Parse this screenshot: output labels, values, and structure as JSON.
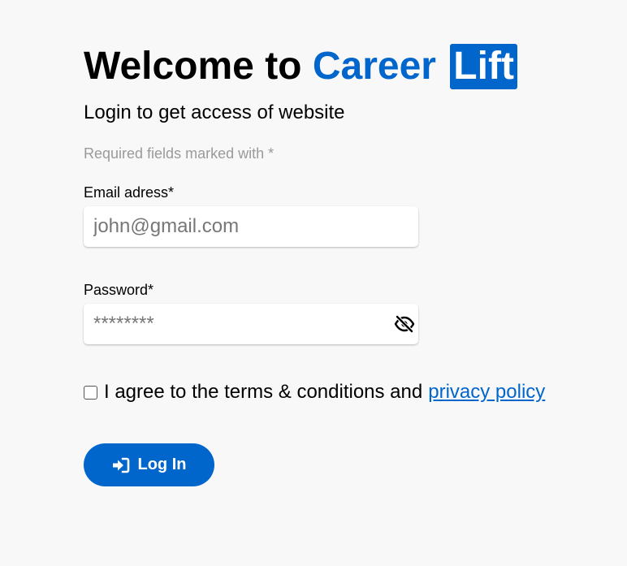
{
  "header": {
    "title_prefix": "Welcome to",
    "brand_name": "Career",
    "brand_badge": "Lift",
    "subtitle": "Login to get access of website"
  },
  "form": {
    "required_note": "Required fields marked with *",
    "email": {
      "label": "Email adress*",
      "placeholder": "john@gmail.com",
      "value": ""
    },
    "password": {
      "label": "Password*",
      "placeholder": "********",
      "value": "",
      "toggle_icon": "eye-slash-icon"
    },
    "agree": {
      "checked": false,
      "text": "I agree to the terms & conditions and",
      "link_text": "privacy policy"
    },
    "submit": {
      "label": "Log In",
      "icon": "sign-in-icon"
    }
  },
  "colors": {
    "accent": "#0066cc",
    "background": "#f8f8f8",
    "muted_text": "#9a9a9a"
  }
}
